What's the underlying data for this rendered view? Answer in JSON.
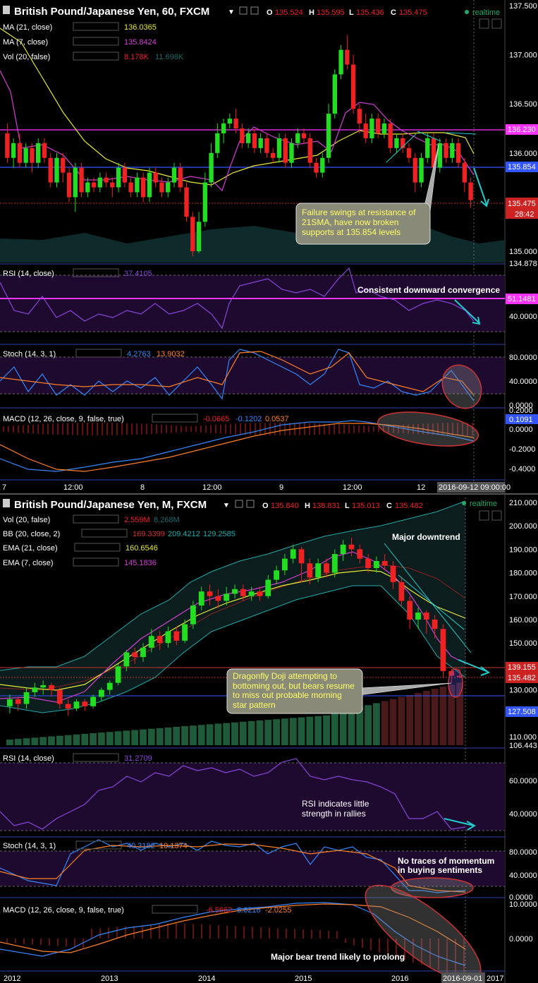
{
  "colors": {
    "bg": "#000000",
    "grid": "#1a1a1a",
    "up": "#22dd22",
    "down": "#ee2222",
    "ma21": "#e8e83a",
    "ma7": "#d040d0",
    "magenta": "#ff33ff",
    "blue": "#3355ff",
    "cyan": "#22cccc",
    "orange": "#ff7f27",
    "redline": "#cc3333",
    "rsiFill": "#1e0a2e",
    "panelSep": "#3344aa",
    "text": "#dddddd",
    "muted": "#999999",
    "label": "#ffffff"
  },
  "top": {
    "header": {
      "title": "British Pound/Japanese Yen, 60, FXCM",
      "o": "O",
      "ov": "135.524",
      "h": "H",
      "hv": "135.595",
      "l": "L",
      "lv": "135.436",
      "c": "C",
      "cv": "135.475",
      "realtime": "realtime"
    },
    "ind1": {
      "name": "MA (21, close)",
      "val": "136.0365"
    },
    "ind2": {
      "name": "MA (7, close)",
      "val": "135.8424"
    },
    "ind3": {
      "name": "Vol (20, false)",
      "v1": "8.178K",
      "v2": "11.698K"
    },
    "yticks": [
      {
        "v": 137.5,
        "t": "137.500"
      },
      {
        "v": 137.0,
        "t": "137.000"
      },
      {
        "v": 136.5,
        "t": "136.500"
      },
      {
        "v": 136.0,
        "t": "136.000"
      },
      {
        "v": 135.0,
        "t": "135.000"
      },
      {
        "v": 134.878,
        "t": "134.878"
      }
    ],
    "levels": {
      "r": "136.230",
      "s": "135.854",
      "last": "135.475",
      "timer": "28:42"
    },
    "annotation": "Failure swings at resistance of 21SMA, have now broken supports at 135.854 levels",
    "rsi": {
      "name": "RSI (14, close)",
      "val": "37.4105",
      "note": "Consistent downward convergence",
      "level": "51.1481",
      "tick": "40.0000"
    },
    "stoch": {
      "name": "Stoch (14, 3, 1)",
      "k": "4.2763",
      "d": "13.9032",
      "ticks": [
        "80.0000",
        "40.0000",
        "0.0000"
      ]
    },
    "macd": {
      "name": "MACD (12, 26, close, 9, false, true)",
      "a": "-0.0665",
      "b": "-0.1202",
      "c": "0.0537",
      "ticks": [
        "0.2000",
        "0.1091",
        "0.0000",
        "-0.2000",
        "-0.4000"
      ]
    },
    "xlabels": [
      "7",
      "12:00",
      "8",
      "12:00",
      "9",
      "12:00",
      "12"
    ],
    "xcursor": "2016-09-12 09:00:00"
  },
  "bottom": {
    "header": {
      "title": "British Pound/Japanese Yen, M, FXCM",
      "o": "O",
      "ov": "135.840",
      "h": "H",
      "hv": "138.831",
      "l": "L",
      "lv": "135.013",
      "c": "C",
      "cv": "135.482",
      "realtime": "realtime"
    },
    "ind1": {
      "name": "Vol (20, false)",
      "v1": "2.559M",
      "v2": "8.268M"
    },
    "ind2": {
      "name": "BB (20, close, 2)",
      "v1": "169.3399",
      "v2": "209.4212",
      "v3": "129.2585"
    },
    "ind3": {
      "name": "EMA (21, close)",
      "val": "160.6546"
    },
    "ind4": {
      "name": "EMA (7, close)",
      "val": "145.1836"
    },
    "yticks": [
      {
        "v": 210,
        "t": "210.000"
      },
      {
        "v": 200,
        "t": "200.000"
      },
      {
        "v": 190,
        "t": "190.000"
      },
      {
        "v": 180,
        "t": "180.000"
      },
      {
        "v": 170,
        "t": "170.000"
      },
      {
        "v": 160,
        "t": "160.000"
      },
      {
        "v": 150,
        "t": "150.000"
      },
      {
        "v": 130,
        "t": "130.000"
      },
      {
        "v": 120,
        "t": "120.000"
      },
      {
        "v": 110,
        "t": "110.000"
      },
      {
        "v": 106.443,
        "t": "106.443"
      }
    ],
    "levels": {
      "r": "139.155",
      "last": "135.482",
      "s": "127.508"
    },
    "note1": "Major downtrend",
    "annotation": "Dragonfly Doji attempting to bottoming out, but bears resume to miss out probable morning star pattern",
    "rsi": {
      "name": "RSI (14, close)",
      "val": "31.2709",
      "note": "RSI indicates little strength in rallies",
      "ticks": [
        "60.0000",
        "40.0000"
      ]
    },
    "stoch": {
      "name": "Stoch (14, 3, 1)",
      "k": "40.3182",
      "d": "10.1374",
      "note": "No traces of momentum in buying sentiments",
      "ticks": [
        "80.0000",
        "40.0000",
        "0.0000"
      ]
    },
    "macd": {
      "name": "MACD (12, 26, close, 9, false, true)",
      "a": "-6.5962",
      "b": "8.6216",
      "c": "-2.0255",
      "note": "Major bear trend likely to prolong",
      "ticks": [
        "10.0000",
        "0.0000"
      ]
    },
    "xlabels": [
      "2012",
      "2013",
      "2014",
      "2015",
      "2016"
    ],
    "xcursor": "2016-09-01",
    "xend": "2017"
  },
  "chart_data": [
    {
      "type": "line",
      "title": "British Pound/Japanese Yen, 60, FXCM",
      "series": [
        {
          "name": "MA (21, close)",
          "values": [
            137.0,
            136.6,
            136.2,
            136.0,
            135.9,
            135.95,
            135.9,
            135.75,
            135.7,
            135.8,
            135.95,
            136.0,
            136.05,
            136.2,
            136.25,
            136.25,
            136.2,
            136.15,
            136.04
          ]
        },
        {
          "name": "MA (7, close)",
          "values": [
            136.7,
            136.1,
            135.8,
            135.9,
            135.85,
            135.6,
            135.75,
            135.8,
            135.7,
            136.0,
            136.15,
            136.05,
            136.2,
            136.55,
            136.4,
            136.2,
            136.1,
            136.2,
            135.84
          ]
        }
      ],
      "ylim": [
        134.878,
        137.5
      ]
    },
    {
      "type": "line",
      "title": "British Pound/Japanese Yen, M, FXCM",
      "series": [
        {
          "name": "EMA (21, close)",
          "values": [
            128,
            127,
            126,
            128,
            135,
            145,
            155,
            165,
            172,
            178,
            182,
            181,
            175,
            160.65
          ]
        },
        {
          "name": "EMA (7, close)",
          "values": [
            124,
            123,
            127,
            135,
            148,
            160,
            170,
            176,
            182,
            187,
            186,
            178,
            160,
            145.18
          ]
        }
      ],
      "ylim": [
        106.443,
        210
      ]
    }
  ]
}
